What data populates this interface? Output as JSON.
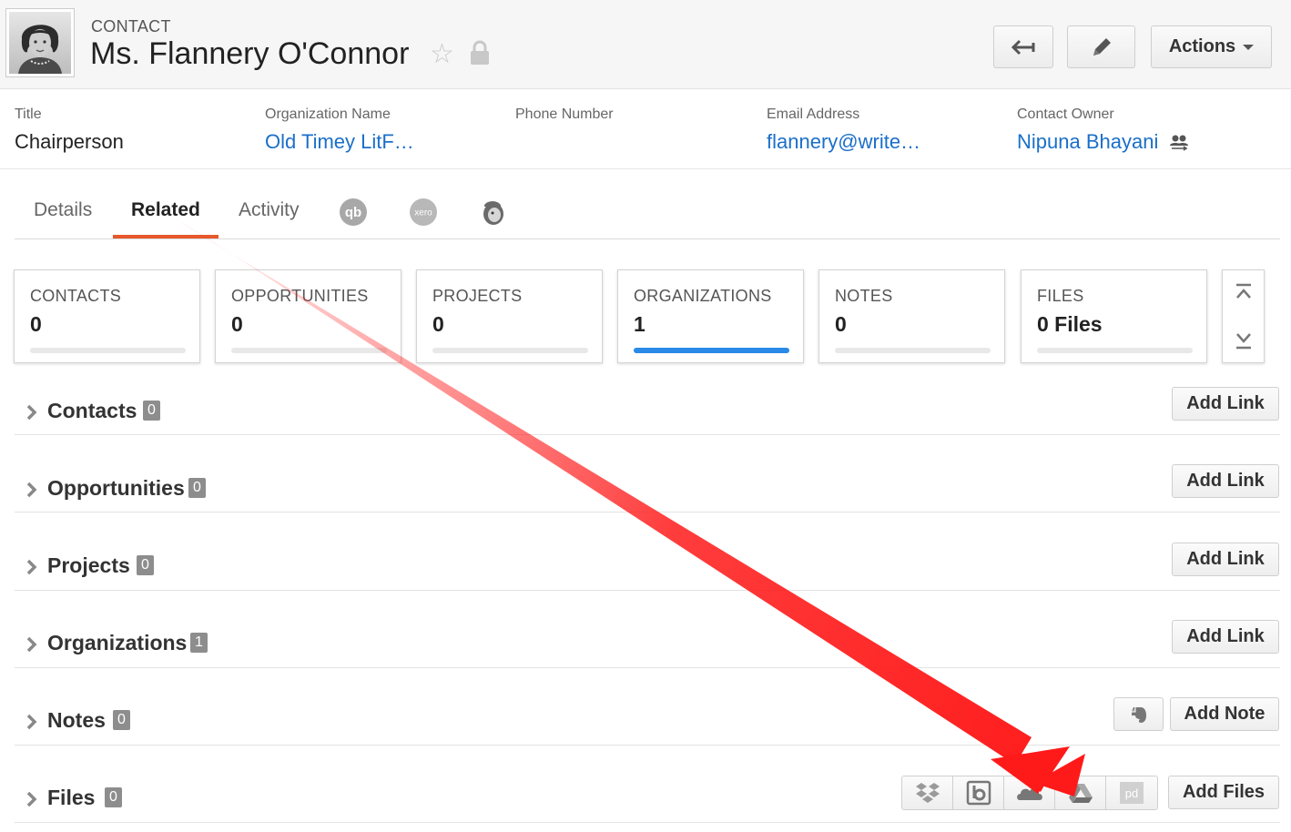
{
  "header": {
    "record_type": "CONTACT",
    "name": "Ms. Flannery O'Connor",
    "actions_label": "Actions"
  },
  "fields": [
    {
      "label": "Title",
      "value": "Chairperson"
    },
    {
      "label": "Organization Name",
      "value": "Old Timey LitF…"
    },
    {
      "label": "Phone Number",
      "value": ""
    },
    {
      "label": "Email Address",
      "value": "flannery@write…"
    },
    {
      "label": "Contact Owner",
      "value": "Nipuna Bhayani"
    }
  ],
  "tabs": [
    {
      "label": "Details"
    },
    {
      "label": "Related"
    },
    {
      "label": "Activity"
    }
  ],
  "integrations": [
    "quickbooks-icon",
    "xero-icon",
    "mailchimp-icon"
  ],
  "cards": [
    {
      "label": "CONTACTS",
      "value": "0",
      "progress": 0
    },
    {
      "label": "OPPORTUNITIES",
      "value": "0",
      "progress": 0
    },
    {
      "label": "PROJECTS",
      "value": "0",
      "progress": 0
    },
    {
      "label": "ORGANIZATIONS",
      "value": "1",
      "progress": 1
    },
    {
      "label": "NOTES",
      "value": "0",
      "progress": 0
    },
    {
      "label": "FILES",
      "value": "0 Files",
      "progress": 0
    }
  ],
  "sections": [
    {
      "title": "Contacts",
      "count": "0",
      "button": "Add Link"
    },
    {
      "title": "Opportunities",
      "count": "0",
      "button": "Add Link"
    },
    {
      "title": "Projects",
      "count": "0",
      "button": "Add Link"
    },
    {
      "title": "Organizations",
      "count": "1",
      "button": "Add Link"
    },
    {
      "title": "Notes",
      "count": "0",
      "button": "Add Note"
    },
    {
      "title": "Files",
      "count": "0",
      "button": "Add Files"
    }
  ],
  "file_providers": [
    "dropbox-icon",
    "box-icon",
    "onedrive-icon",
    "google-drive-icon",
    "pandadoc-icon"
  ],
  "colors": {
    "accent_tab": "#e8582b",
    "link": "#1a6fc9",
    "progress": "#2a8ae8",
    "annotation_arrow": "#ff1a1a"
  }
}
